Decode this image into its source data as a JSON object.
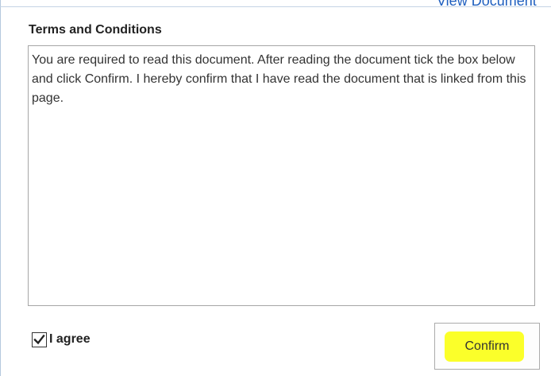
{
  "header": {
    "view_document_link": "View Document"
  },
  "terms": {
    "heading": "Terms and Conditions",
    "text": "You are required to read this document. After reading the document tick the box below and click Confirm. I hereby confirm that I have read the document that is linked from this page."
  },
  "agree": {
    "label": "I agree",
    "checked": true,
    "icon": "checkmark-icon"
  },
  "confirm": {
    "label": "Confirm",
    "highlight_color": "#fbff2a"
  },
  "colors": {
    "link": "#1f5fbf",
    "text": "#333333",
    "border": "#a6a6a6"
  }
}
